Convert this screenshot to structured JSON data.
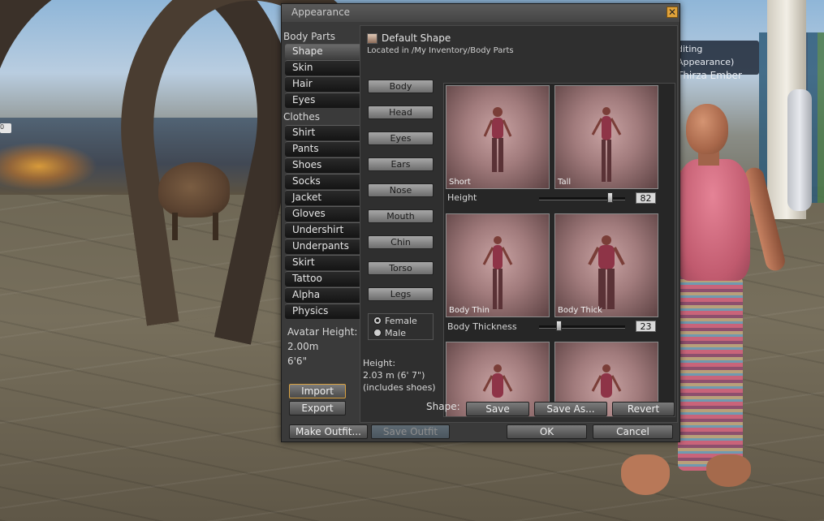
{
  "scene": {
    "editing_tag_line1": "diting Appearance)",
    "editing_tag_line2": "Thirza Ember",
    "left_tag": "0"
  },
  "floater": {
    "title": "Appearance",
    "close_icon": "close-icon",
    "body_parts_label": "Body Parts",
    "clothes_label": "Clothes",
    "body_parts": [
      "Shape",
      "Skin",
      "Hair",
      "Eyes"
    ],
    "clothes": [
      "Shirt",
      "Pants",
      "Shoes",
      "Socks",
      "Jacket",
      "Gloves",
      "Undershirt",
      "Underpants",
      "Skirt",
      "Tattoo",
      "Alpha",
      "Physics"
    ],
    "selected_tab": "Shape",
    "avatar_height_label": "Avatar Height:",
    "avatar_height_m": "2.00m",
    "avatar_height_ft": "6'6\"",
    "import_label": "Import",
    "export_label": "Export",
    "make_outfit_label": "Make Outfit...",
    "save_outfit_label": "Save Outfit",
    "ok_label": "OK",
    "cancel_label": "Cancel"
  },
  "shape_panel": {
    "title": "Default Shape",
    "location": "Located in /My Inventory/Body Parts",
    "regions": [
      "Body",
      "Head",
      "Eyes",
      "Ears",
      "Nose",
      "Mouth",
      "Chin",
      "Torso",
      "Legs"
    ],
    "gender": {
      "female": "Female",
      "male": "Male",
      "selected": "Female"
    },
    "height_info": [
      "Height:",
      "2.03 m (6' 7\")",
      "(includes shoes)"
    ],
    "shape_label": "Shape:",
    "save_label": "Save",
    "save_as_label": "Save As...",
    "revert_label": "Revert",
    "params": [
      {
        "label": "Height",
        "left": "Short",
        "right": "Tall",
        "value": "82",
        "fraction": 0.82
      },
      {
        "label": "Body Thickness",
        "left": "Body Thin",
        "right": "Body Thick",
        "value": "23",
        "fraction": 0.23
      }
    ]
  },
  "colors": {
    "floater_bg": "#3a3a3a",
    "selected_tab": "#5a5a5a",
    "highlight_border": "#d8a040",
    "close_button": "#e0a23a"
  }
}
